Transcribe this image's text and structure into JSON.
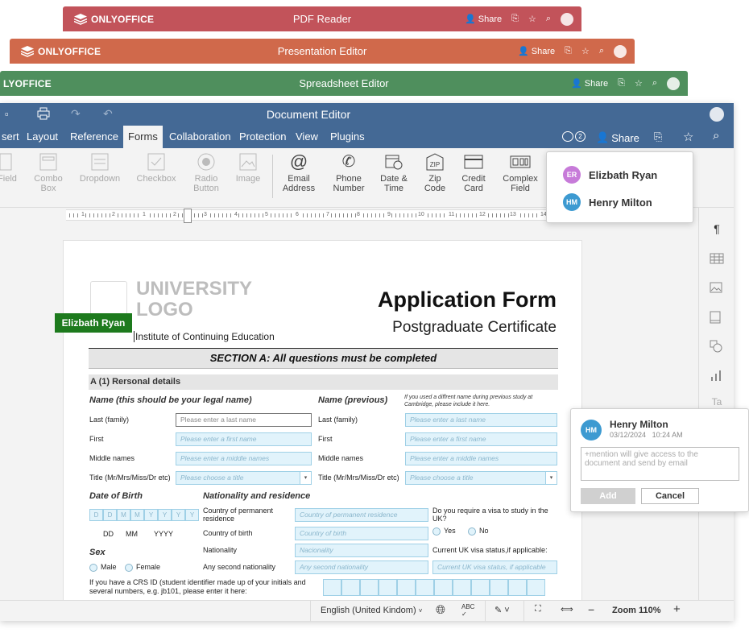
{
  "windows": {
    "pdf": {
      "logo": "ONLYOFFICE",
      "title": "PDF Reader",
      "share": "Share",
      "color": "#c2535a"
    },
    "presentation": {
      "logo": "ONLYOFFICE",
      "title": "Presentation Editor",
      "share": "Share",
      "color": "#d0694b"
    },
    "spreadsheet": {
      "logo": "LYOFFICE",
      "title": "Spreadsheet Editor",
      "share": "Share",
      "color": "#4f8f5d"
    }
  },
  "doc": {
    "title": "Document Editor",
    "color": "#446995",
    "tabs": [
      "sert",
      "Layout",
      "Reference",
      "Forms",
      "Collaboration",
      "Protection",
      "View",
      "Plugins"
    ],
    "active_tab": "Forms",
    "share": "Share",
    "users_count": "2",
    "toolbar": [
      {
        "label": "Field",
        "dim": true
      },
      {
        "label": "Combo\nBox",
        "dim": true
      },
      {
        "label": "Dropdown",
        "dim": true
      },
      {
        "label": "Checkbox",
        "dim": true
      },
      {
        "label": "Radio\nButton",
        "dim": true
      },
      {
        "label": "Image",
        "dim": true
      },
      {
        "label": "Email\nAddress",
        "dim": false
      },
      {
        "label": "Phone\nNumber",
        "dim": false
      },
      {
        "label": "Date &\nTime",
        "dim": false
      },
      {
        "label": "Zip\nCode",
        "dim": false
      },
      {
        "label": "Credit\nCard",
        "dim": false
      },
      {
        "label": "Complex\nField",
        "dim": false
      }
    ],
    "ruler_ticks": [
      "1",
      "2",
      "1",
      "2",
      "3",
      "4",
      "5",
      "6",
      "7",
      "8",
      "9",
      "10",
      "11",
      "12",
      "13",
      "14"
    ]
  },
  "users_popup": [
    {
      "initials": "ER",
      "name": "Elizbath Ryan",
      "color": "#c77bd9"
    },
    {
      "initials": "HM",
      "name": "Henry Milton",
      "color": "#3d9ad1"
    }
  ],
  "cursor_tag": "Elizbath Ryan",
  "comment": {
    "initials": "HM",
    "name": "Henry Milton",
    "date": "03/12/2024",
    "time": "10:24 AM",
    "placeholder": "+mention will give access to the document and send by email",
    "add": "Add",
    "cancel": "Cancel"
  },
  "form": {
    "logo_line1": "UNIVERSITY",
    "logo_line2": "LOGO",
    "institute": "Institute of Continuing Education",
    "title": "Application Form",
    "subtitle": "Postgraduate Certificate",
    "section": "SECTION A: All questions must be completed",
    "subsection": "A (1) Rersonal details",
    "name_legal": "Name (this should be your legal name)",
    "name_prev": "Name (previous)",
    "name_prev_note": "If you used a diffrent name during previous study at Cambridge, please include it here.",
    "rows": [
      {
        "label": "Last (family)",
        "ph": "Please enter a last name",
        "label2": "Last (family)",
        "ph2": "Please enter a last name"
      },
      {
        "label": "First",
        "ph": "Please enter a first name",
        "label2": "First",
        "ph2": "Please enter a first name"
      },
      {
        "label": "Middle names",
        "ph": "Please enter a middle names",
        "label2": "Middle names",
        "ph2": "Please enter a middle names"
      },
      {
        "label": "Title (Mr/Mrs/Miss/Dr etc)",
        "ph": "Please choose a title",
        "label2": "Title (Mr/Mrs/Miss/Dr etc)",
        "ph2": "Please choose a title"
      }
    ],
    "dob": "Date of Birth",
    "dob_boxes": [
      "D",
      "D",
      "M",
      "M",
      "Y",
      "Y",
      "Y",
      "Y"
    ],
    "dob_legend": [
      "DD",
      "MM",
      "YYYY"
    ],
    "nationality": "Nationality and residence",
    "nat_rows": [
      {
        "label": "Country of permanent residence",
        "ph": "Country of permanent residence"
      },
      {
        "label": "Country of birth",
        "ph": "Country of birth"
      },
      {
        "label": "Nationality",
        "ph": "Nacionality"
      },
      {
        "label": "Any second nationality",
        "ph": "Any second nationality"
      }
    ],
    "visa_q": "Do you require a visa to study in the UK?",
    "yes": "Yes",
    "no": "No",
    "visa_status": "Current UK visa status,if applicable:",
    "visa_ph": "Current UK visa status, if applicable",
    "sex": "Sex",
    "male": "Male",
    "female": "Female",
    "crs": "If you have a CRS ID (student identifier made up of your initials and several numbers, e.g. jb101, please enter it here:"
  },
  "status": {
    "language": "English (United Kindom)",
    "zoom": "Zoom 110%"
  }
}
